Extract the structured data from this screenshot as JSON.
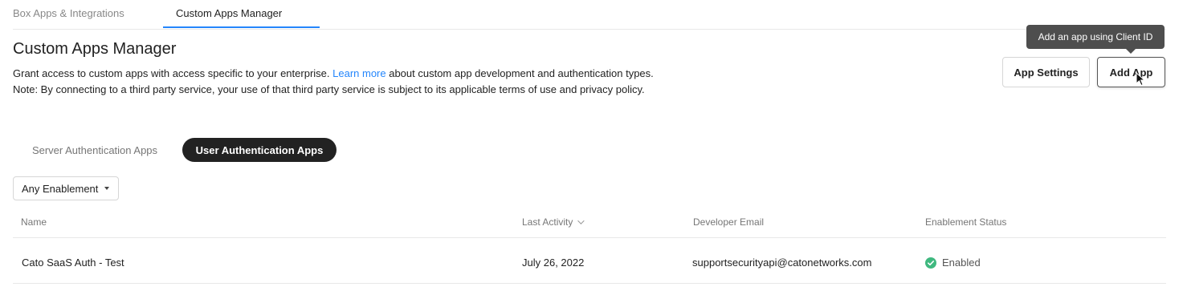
{
  "top_tabs": {
    "apps_integrations": "Box Apps & Integrations",
    "custom_apps_manager": "Custom Apps Manager"
  },
  "header": {
    "title": "Custom Apps Manager",
    "description_part1": "Grant access to custom apps with access specific to your enterprise. ",
    "learn_more": "Learn more",
    "description_part2": " about custom app development and authentication types. Note: By connecting to a third party service, your use of that third party service is subject to its applicable terms of use and privacy policy."
  },
  "actions": {
    "app_settings": "App Settings",
    "add_app": "Add App",
    "add_app_tooltip": "Add an app using Client ID"
  },
  "sub_tabs": {
    "server_auth": "Server Authentication Apps",
    "user_auth": "User Authentication Apps"
  },
  "filter": {
    "enablement_selected": "Any Enablement"
  },
  "table": {
    "columns": {
      "name": "Name",
      "last_activity": "Last Activity",
      "developer_email": "Developer Email",
      "enablement_status": "Enablement Status"
    },
    "rows": [
      {
        "name": "Cato SaaS Auth - Test",
        "last_activity": "July 26, 2022",
        "developer_email": "supportsecurityapi@catonetworks.com",
        "enablement_status": "Enabled"
      }
    ]
  },
  "colors": {
    "accent": "#2486fc",
    "enabled_green": "#3fb87f",
    "active_pill": "#222222",
    "tooltip_bg": "#4e4e4e"
  },
  "icons": {
    "sort": "chevron-down-icon",
    "status": "check-circle-icon",
    "cursor": "mouse-pointer-icon"
  }
}
